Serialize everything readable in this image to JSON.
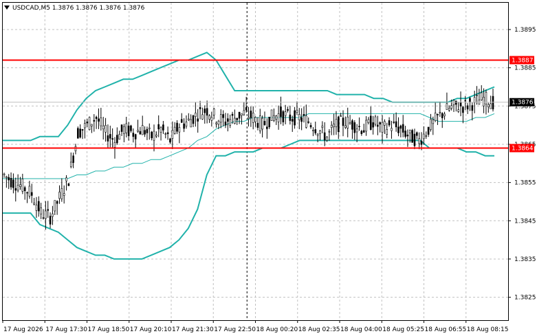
{
  "header": {
    "symbol_line": "USDCAD,M5  1.3876 1.3876 1.3876 1.3876"
  },
  "colors": {
    "band_outer": "#20b2aa",
    "band_middle": "#20b2aa",
    "candles": "#000000",
    "level_line": "#ff0000",
    "level_label_bg": "#ff0000",
    "price_label_bg": "#000000",
    "grid": "#c0c0c0"
  },
  "chart_data": {
    "type": "line",
    "title": "USDCAD,M5  1.3876 1.3876 1.3876 1.3876",
    "ylim": [
      1.3819,
      1.3902
    ],
    "y_ticks": [
      "1.3895",
      "1.3885",
      "1.3875",
      "1.3865",
      "1.3855",
      "1.3845",
      "1.3835",
      "1.3825"
    ],
    "x_ticks": [
      "17 Aug 2026",
      "17 Aug 17:30",
      "17 Aug 18:50",
      "17 Aug 20:10",
      "17 Aug 21:30",
      "17 Aug 22:50",
      "18 Aug 00:20",
      "18 Aug 02:35",
      "18 Aug 04:00",
      "18 Aug 05:25",
      "18 Aug 06:55",
      "18 Aug 08:15"
    ],
    "horizontal_levels": [
      {
        "value": 1.3887,
        "label": "1.3887"
      },
      {
        "value": 1.3864,
        "label": "1.3864"
      }
    ],
    "current_price": {
      "value": 1.3876,
      "label": "1.3876"
    },
    "vertical_marker_index": 5.8,
    "series": [
      {
        "role": "upper-band",
        "values": [
          1.3866,
          1.3866,
          1.3866,
          1.3866,
          1.3867,
          1.3867,
          1.3867,
          1.387,
          1.3874,
          1.3877,
          1.3879,
          1.388,
          1.3881,
          1.3882,
          1.3882,
          1.3883,
          1.3884,
          1.3885,
          1.3886,
          1.3887,
          1.3887,
          1.3888,
          1.3889,
          1.3887,
          1.3883,
          1.3879,
          1.3879,
          1.3879,
          1.3879,
          1.3879,
          1.3879,
          1.3879,
          1.3879,
          1.3879,
          1.3879,
          1.3879,
          1.3878,
          1.3878,
          1.3878,
          1.3878,
          1.3877,
          1.3877,
          1.3876,
          1.3876,
          1.3876,
          1.3876,
          1.3876,
          1.3876,
          1.3876,
          1.3877,
          1.3877,
          1.3878,
          1.3879,
          1.388
        ]
      },
      {
        "role": "middle-band",
        "values": [
          1.3856,
          1.3856,
          1.3856,
          1.3856,
          1.3856,
          1.3856,
          1.3856,
          1.3856,
          1.3857,
          1.3857,
          1.3858,
          1.3858,
          1.3859,
          1.3859,
          1.386,
          1.386,
          1.3861,
          1.3861,
          1.3862,
          1.3863,
          1.3864,
          1.3866,
          1.3867,
          1.3869,
          1.387,
          1.3871,
          1.3871,
          1.3872,
          1.3872,
          1.3872,
          1.3872,
          1.3872,
          1.3872,
          1.3873,
          1.3873,
          1.3873,
          1.3873,
          1.3873,
          1.3873,
          1.3873,
          1.3873,
          1.3873,
          1.3873,
          1.3873,
          1.3873,
          1.3873,
          1.3872,
          1.3871,
          1.3871,
          1.3871,
          1.3871,
          1.3872,
          1.3872,
          1.3873
        ]
      },
      {
        "role": "lower-band",
        "values": [
          1.3847,
          1.3847,
          1.3847,
          1.3847,
          1.3844,
          1.3843,
          1.3842,
          1.384,
          1.3838,
          1.3837,
          1.3836,
          1.3836,
          1.3835,
          1.3835,
          1.3835,
          1.3835,
          1.3836,
          1.3837,
          1.3838,
          1.384,
          1.3843,
          1.3848,
          1.3857,
          1.3862,
          1.3862,
          1.3863,
          1.3863,
          1.3863,
          1.3864,
          1.3864,
          1.3864,
          1.3865,
          1.3866,
          1.3866,
          1.3866,
          1.3866,
          1.3866,
          1.3866,
          1.3866,
          1.3866,
          1.3866,
          1.3866,
          1.3866,
          1.3866,
          1.3866,
          1.3866,
          1.3864,
          1.3864,
          1.3864,
          1.3864,
          1.3863,
          1.3863,
          1.3862,
          1.3862
        ]
      },
      {
        "role": "price",
        "values": [
          1.3857,
          1.3855,
          1.3854,
          1.3852,
          1.3847,
          1.3846,
          1.3851,
          1.3856,
          1.3868,
          1.387,
          1.3872,
          1.3868,
          1.3866,
          1.3869,
          1.3868,
          1.3869,
          1.3867,
          1.3869,
          1.3866,
          1.387,
          1.3871,
          1.3873,
          1.3874,
          1.3872,
          1.3871,
          1.3872,
          1.3873,
          1.3872,
          1.387,
          1.3872,
          1.3873,
          1.3872,
          1.3872,
          1.3871,
          1.3869,
          1.3867,
          1.387,
          1.3871,
          1.387,
          1.3869,
          1.3871,
          1.3869,
          1.387,
          1.3869,
          1.3867,
          1.3866,
          1.3869,
          1.3872,
          1.3874,
          1.3875,
          1.3875,
          1.3876,
          1.3877,
          1.3876
        ]
      }
    ]
  }
}
